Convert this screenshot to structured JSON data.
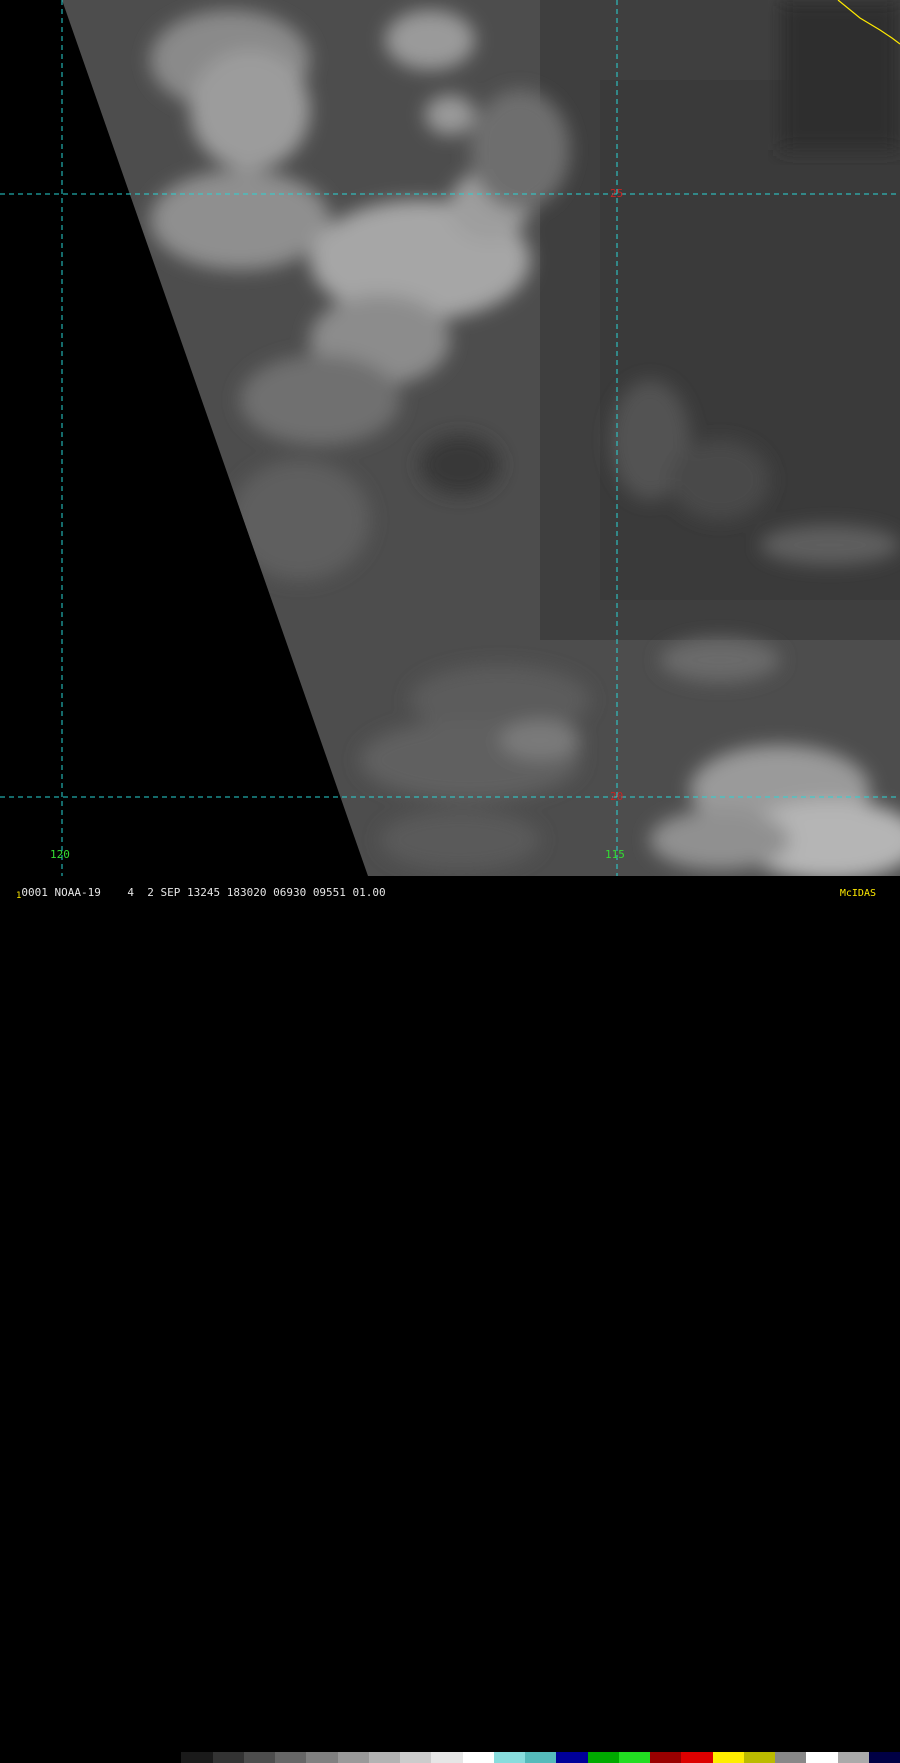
{
  "image": {
    "description_colors": {
      "swath_gray": "#4e4e4e",
      "cloud_light": "#b5b5b5",
      "no_data": "#000000",
      "grid_line": "#29d5d5",
      "coastline": "#ffea00"
    }
  },
  "grid": {
    "longitude_labels": [
      "120",
      "115"
    ],
    "latitude_labels": [
      "25",
      "20"
    ]
  },
  "caption": {
    "frame": "1",
    "text": "0001 NOAA-19    4  2 SEP 13245 183020 06930 09551 01.00"
  },
  "colorbar": {
    "segments": [
      "#000000",
      "#1a1a1a",
      "#333333",
      "#4d4d4d",
      "#666666",
      "#808080",
      "#999999",
      "#b3b3b3",
      "#cccccc",
      "#e6e6e6",
      "#ffffff",
      "#88dddd",
      "#55bbbb",
      "#000099",
      "#00aa00",
      "#22dd22",
      "#990000",
      "#dd0000",
      "#ffee00",
      "#bbbb00",
      "#888888",
      "#ffffff",
      "#aaaaaa",
      "#000044"
    ]
  },
  "brand": "McIDAS"
}
